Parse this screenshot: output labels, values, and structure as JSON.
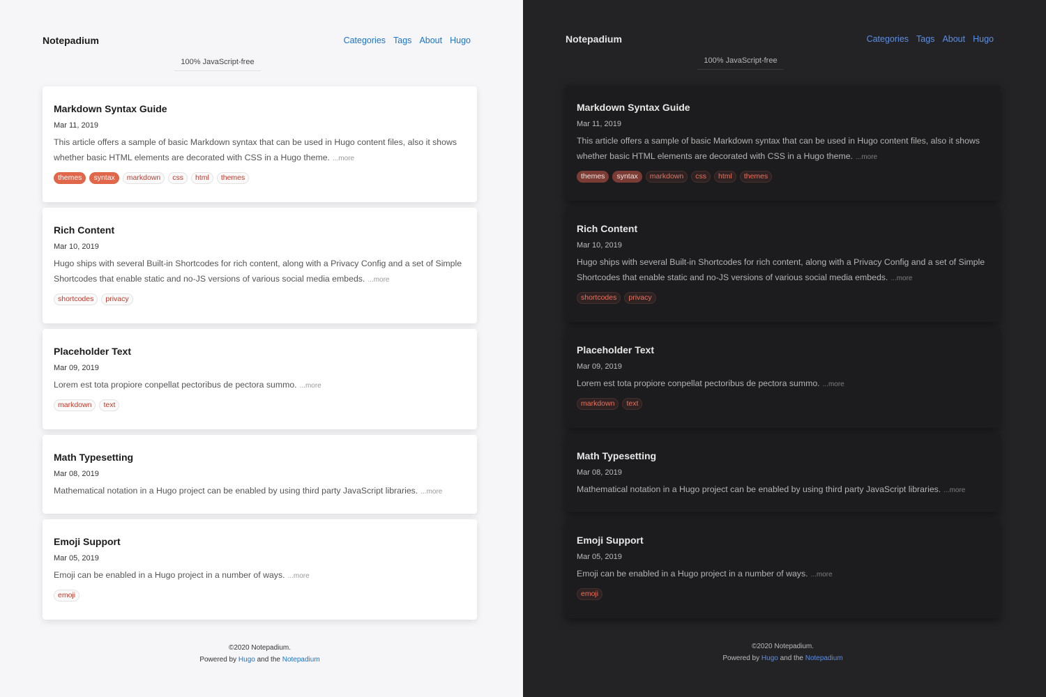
{
  "site": {
    "title": "Notepadium",
    "tagline": "100% JavaScript-free",
    "nav": [
      "Categories",
      "Tags",
      "About",
      "Hugo"
    ]
  },
  "posts": [
    {
      "title": "Markdown Syntax Guide",
      "date": "Mar 11, 2019",
      "summary": "This article offers a sample of basic Markdown syntax that can be used in Hugo content files, also it shows whether basic HTML elements are decorated with CSS in a Hugo theme.",
      "more": "...more",
      "tags": [
        "themes",
        "syntax",
        "markdown",
        "css",
        "html",
        "themes"
      ]
    },
    {
      "title": "Rich Content",
      "date": "Mar 10, 2019",
      "summary": "Hugo ships with several Built-in Shortcodes for rich content, along with a Privacy Config and a set of Simple Shortcodes that enable static and no-JS versions of various social media embeds.",
      "more": "...more",
      "tags": [
        "shortcodes",
        "privacy"
      ]
    },
    {
      "title": "Placeholder Text",
      "date": "Mar 09, 2019",
      "summary": "Lorem est tota propiore conpellat pectoribus de pectora summo.",
      "more": "...more",
      "tags": [
        "markdown",
        "text"
      ]
    },
    {
      "title": "Math Typesetting",
      "date": "Mar 08, 2019",
      "summary": "Mathematical notation in a Hugo project can be enabled by using third party JavaScript libraries.",
      "more": "...more",
      "tags": []
    },
    {
      "title": "Emoji Support",
      "date": "Mar 05, 2019",
      "summary": "Emoji can be enabled in a Hugo project in a number of ways.",
      "more": "...more",
      "tags": [
        "emoji"
      ]
    }
  ],
  "footer": {
    "copyright": "©2020 Notepadium.",
    "powered_prefix": "Powered by",
    "hugo_link": "Hugo",
    "and_the": "and the",
    "theme_link": "Notepadium"
  },
  "colors": {
    "light_background": "#f6f6f8",
    "dark_background": "#232325",
    "link_blue": "#1a73c8",
    "tag_red": "#c1392b",
    "tag_highlight": "#e0674a"
  }
}
